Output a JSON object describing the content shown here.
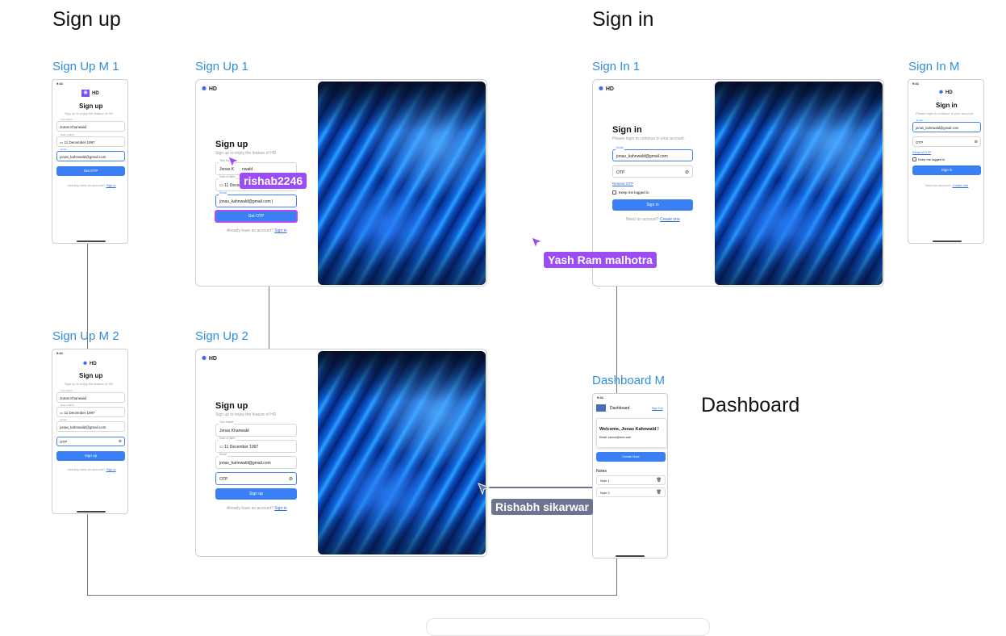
{
  "sections": {
    "signup": "Sign up",
    "signin": "Sign in",
    "dashboard": "Dashboard"
  },
  "frames": {
    "signup_m1": "Sign Up M 1",
    "signup_1": "Sign Up 1",
    "signin_1": "Sign In 1",
    "signin_m": "Sign In M",
    "signup_m2": "Sign Up M 2",
    "signup_2": "Sign Up 2",
    "dashboard_m": "Dashboard M"
  },
  "common": {
    "time": "9:41",
    "logo": "HD",
    "signup_title": "Sign up",
    "signup_subtitle": "Sign up to enjoy the feature of HD",
    "signin_title": "Sign in",
    "signin_subtitle": "Please login to continue to your account.",
    "name_label": "Your Name",
    "name_value": "Jonas Khanwald",
    "dob_label": "Date of Birth",
    "dob_value": "11 December 1997",
    "email_label": "Email",
    "email_value": "jonas_kahnwald@gmail.com",
    "otp_placeholder": "OTP",
    "get_otp": "Get OTP",
    "sign_up_btn": "Sign up",
    "sign_in_btn": "Sign in",
    "have_account": "Already have an account?",
    "sign_in_link": "Sign in",
    "need_account": "Need an account?",
    "create_one": "Create one",
    "resend_otp": "Resend OTP",
    "keep_logged": "Keep me logged in"
  },
  "signup1": {
    "name_partial_left": "Jonas K",
    "name_partial_right": "nwald",
    "dob_partial": "11 Decem",
    "email_typed": "jonas_kahnwald@gmail.com |"
  },
  "dashboard": {
    "title": "Dashboard",
    "sign_out": "Sign Out",
    "welcome": "Welcome, Jonas Kahnwald !",
    "email_line": "Email: xxxxxx@xxxx.com",
    "create_note": "Create Note",
    "notes_heading": "Notes",
    "notes": [
      "Note 1",
      "Note 2"
    ]
  },
  "cursors": {
    "rishab": {
      "name": "rishab2246",
      "color": "#9b4cf5"
    },
    "yash": {
      "name": "Yash Ram malhotra",
      "color": "#9b4cf5"
    },
    "rishabh": {
      "name": "Rishabh sikarwar",
      "color": "#6b7590"
    }
  }
}
